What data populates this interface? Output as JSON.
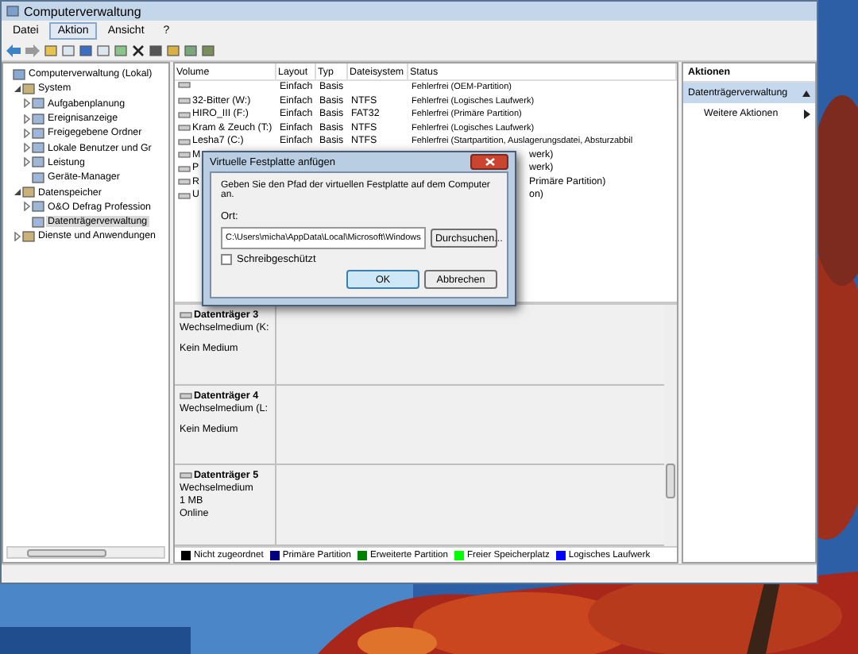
{
  "window": {
    "title": "Computerverwaltung"
  },
  "menu": [
    {
      "label": "Datei",
      "selected": false
    },
    {
      "label": "Aktion",
      "selected": true
    },
    {
      "label": "Ansicht",
      "selected": false
    },
    {
      "label": "?",
      "selected": false
    }
  ],
  "tree": [
    {
      "label": "Computerverwaltung (Lokal)",
      "selected": false,
      "children": [
        {
          "label": "System",
          "expanded": true,
          "selected": false,
          "children": [
            {
              "label": "Aufgabenplanung",
              "expanded": false,
              "selected": false
            },
            {
              "label": "Ereignisanzeige",
              "expanded": false,
              "selected": false
            },
            {
              "label": "Freigegebene Ordner",
              "expanded": false,
              "selected": false
            },
            {
              "label": "Lokale Benutzer und Gr",
              "expanded": false,
              "selected": false
            },
            {
              "label": "Leistung",
              "expanded": false,
              "selected": false
            },
            {
              "label": "Geräte-Manager",
              "selected": false
            }
          ]
        },
        {
          "label": "Datenspeicher",
          "expanded": true,
          "selected": false,
          "children": [
            {
              "label": "O&O Defrag Profession",
              "expanded": false,
              "selected": false
            },
            {
              "label": "Datenträgerverwaltung",
              "selected": true
            }
          ]
        },
        {
          "label": "Dienste und Anwendungen",
          "expanded": false,
          "selected": false
        }
      ]
    }
  ],
  "table": {
    "columns": [
      "Volume",
      "Layout",
      "Typ",
      "Dateisystem",
      "Status"
    ],
    "rows": [
      {
        "kind": "full",
        "cells": [
          "",
          "Einfach",
          "Basis",
          "",
          "Fehlerfrei (OEM-Partition)"
        ]
      },
      {
        "kind": "full",
        "cells": [
          "32-Bitter (W:)",
          "Einfach",
          "Basis",
          "NTFS",
          "Fehlerfrei (Logisches Laufwerk)"
        ]
      },
      {
        "kind": "full",
        "cells": [
          "HIRO_III (F:)",
          "Einfach",
          "Basis",
          "FAT32",
          "Fehlerfrei (Primäre Partition)"
        ]
      },
      {
        "kind": "full",
        "cells": [
          "Kram & Zeuch (T:)",
          "Einfach",
          "Basis",
          "NTFS",
          "Fehlerfrei (Logisches Laufwerk)"
        ]
      },
      {
        "kind": "full",
        "cells": [
          "Lesha7 (C:)",
          "Einfach",
          "Basis",
          "NTFS",
          "Fehlerfrei (Startpartition, Auslagerungsdatei, Absturzabbil"
        ]
      },
      {
        "kind": "covered",
        "cells": [
          "M",
          "",
          "",
          "",
          "werk)"
        ]
      },
      {
        "kind": "covered",
        "cells": [
          "P",
          "",
          "",
          "",
          "werk)"
        ]
      },
      {
        "kind": "covered",
        "cells": [
          "R",
          "",
          "",
          "",
          "Primäre Partition)"
        ]
      },
      {
        "kind": "covered",
        "cells": [
          "U",
          "",
          "",
          "",
          "on)"
        ]
      }
    ]
  },
  "disks": [
    {
      "name": "Datenträger 3",
      "lines": [
        "Wechselmedium (K:",
        "Kein Medium"
      ]
    },
    {
      "name": "Datenträger 4",
      "lines": [
        "Wechselmedium (L:",
        "Kein Medium"
      ]
    },
    {
      "name": "Datenträger 5",
      "lines": [
        "Wechselmedium",
        "1 MB",
        "Online"
      ]
    }
  ],
  "legend": [
    {
      "label": "Nicht zugeordnet",
      "color": "#000000"
    },
    {
      "label": "Primäre Partition",
      "color": "#000080"
    },
    {
      "label": "Erweiterte Partition",
      "color": "#008000"
    },
    {
      "label": "Freier Speicherplatz",
      "color": "#00ff00"
    },
    {
      "label": "Logisches Laufwerk",
      "color": "#0000ff"
    }
  ],
  "actions": {
    "title": "Aktionen",
    "section": "Datenträgerverwaltung",
    "items": [
      "Weitere Aktionen"
    ]
  },
  "dialog": {
    "title": "Virtuelle Festplatte anfügen",
    "message": "Geben Sie den Pfad der virtuellen Festplatte auf dem Computer an.",
    "location_label": "Ort:",
    "location_value": "C:\\Users\\micha\\AppData\\Local\\Microsoft\\Windows",
    "browse": "Durchsuchen...",
    "readonly": {
      "label": "Schreibgeschützt",
      "checked": false
    },
    "ok": "OK",
    "cancel": "Abbrechen"
  }
}
